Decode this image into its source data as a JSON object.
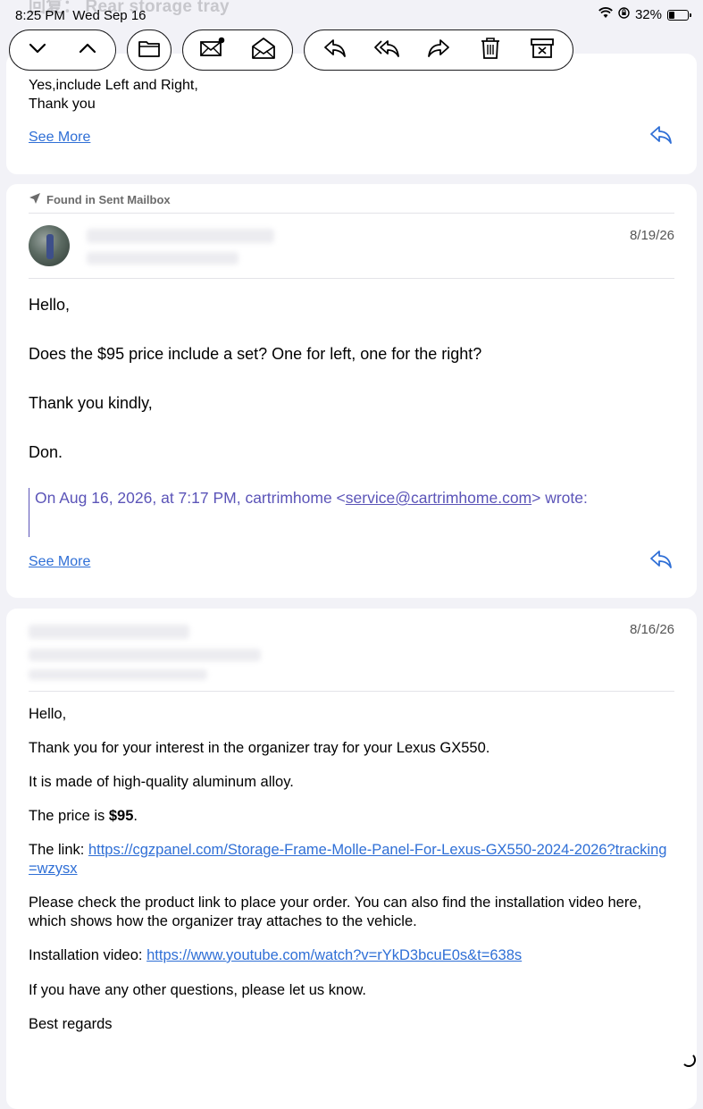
{
  "status_bar": {
    "time": "8:25 PM",
    "date": "Wed Sep 16",
    "battery_percent": "32%",
    "battery_level": 0.32,
    "subject_behind": "回复： Rear storage tray"
  },
  "toolbar": {
    "buttons": [
      "chevron-down",
      "chevron-up",
      "folder",
      "mark-unread",
      "read-envelope",
      "reply",
      "reply-all",
      "forward",
      "trash",
      "archive"
    ]
  },
  "message1": {
    "lines": [
      "Yes,include Left and Right,",
      "Thank you"
    ],
    "see_more": "See More"
  },
  "message2": {
    "found_in": "Found in Sent Mailbox",
    "date": "8/19/26",
    "lines": [
      "Hello,",
      "Does the $95 price include a set?  One for left, one for the right?",
      "Thank you kindly,",
      "Don."
    ],
    "quote_prefix": "On Aug 16, 2026, at 7:17 PM, cartrimhome <",
    "quote_email": "service@cartrimhome.com",
    "quote_suffix": "> wrote:",
    "see_more": "See More"
  },
  "message3": {
    "date": "8/16/26",
    "greeting": "Hello,",
    "p1": "Thank you for your interest in the organizer tray for your Lexus GX550.",
    "p2": "It is made of high-quality aluminum alloy.",
    "price_label": "The price is ",
    "price_value": "$95",
    "price_end": ".",
    "link_label": "The link: ",
    "link_url": "https://cgzpanel.com/Storage-Frame-Molle-Panel-For-Lexus-GX550-2024-2026?tracking=wzysx",
    "p3": "Please check the product link to place your order. You can also find the installation video here, which shows how the organizer tray attaches to the vehicle.",
    "video_label": "Installation video: ",
    "video_url": "https://www.youtube.com/watch?v=rYkD3bcuE0s&t=638s",
    "p4": "If you have any other questions, please let us know.",
    "closing": "Best regards"
  }
}
